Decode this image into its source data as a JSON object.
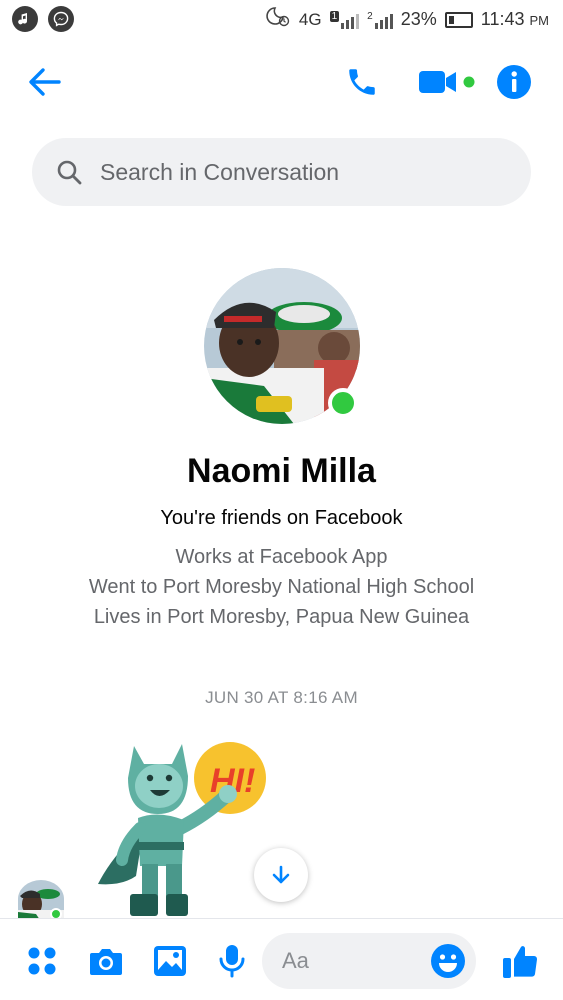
{
  "status_bar": {
    "network": "4G",
    "sim1": "1",
    "sim2": "2",
    "battery": "23%",
    "time": "11:43",
    "ampm": "PM"
  },
  "colors": {
    "accent": "#0084ff",
    "online": "#31c940",
    "search_bg": "#f0f1f3",
    "secondary_text": "#65676b"
  },
  "header": {
    "icons": [
      "back-arrow-icon",
      "phone-icon",
      "video-camera-icon",
      "info-icon"
    ]
  },
  "search": {
    "placeholder": "Search in Conversation"
  },
  "profile": {
    "name": "Naomi Milla",
    "relationship": "You're friends on Facebook",
    "work": "Works at Facebook App",
    "education": "Went to Port Moresby National High School",
    "location": "Lives in Port Moresby, Papua New Guinea",
    "online": true
  },
  "conversation": {
    "timestamp": "JUN 30 AT 8:16 AM",
    "sticker_text": "HI!"
  },
  "composer": {
    "placeholder": "Aa",
    "icons": [
      "menu-dots-icon",
      "camera-icon",
      "gallery-icon",
      "microphone-icon",
      "emoji-icon",
      "thumbs-up-icon"
    ]
  }
}
